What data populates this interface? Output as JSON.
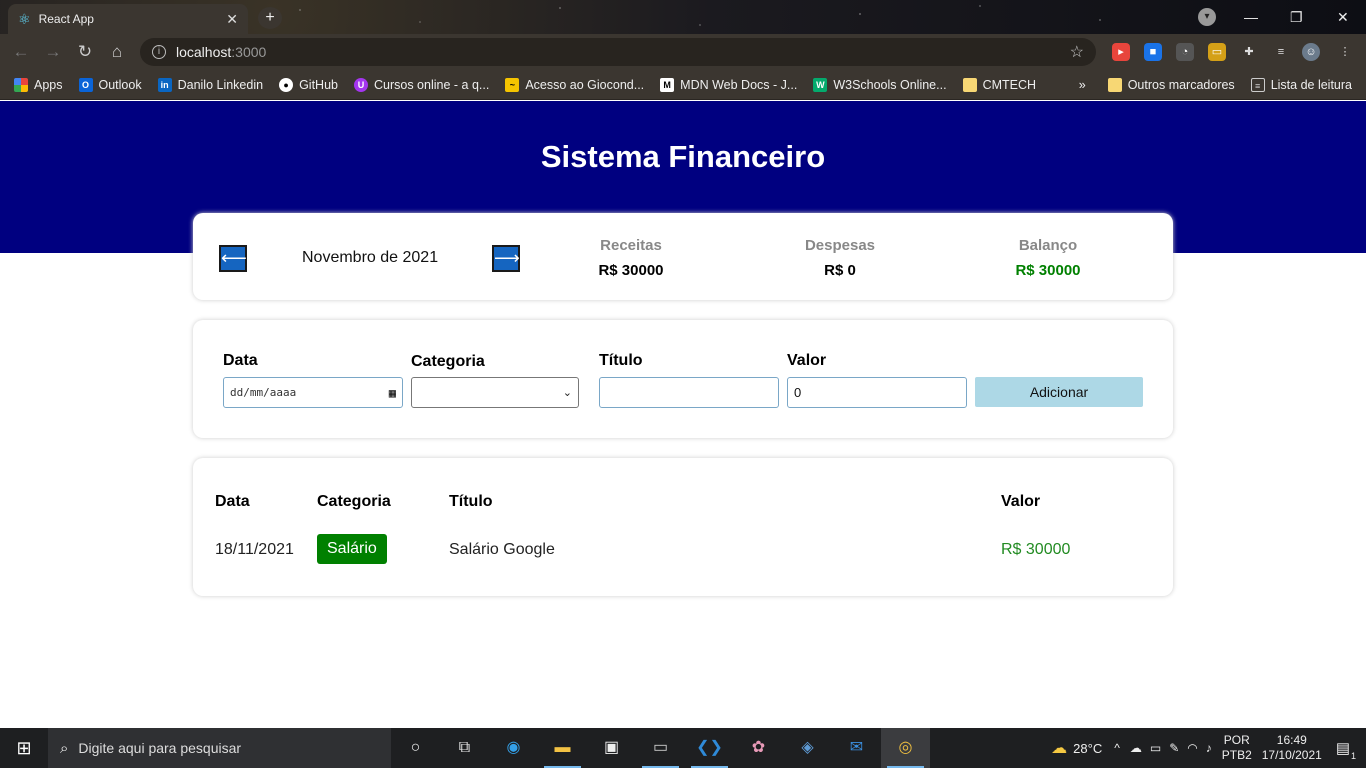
{
  "browser": {
    "tab_title": "React App",
    "tab_close": "✕",
    "new_tab": "+",
    "url_host": "localhost",
    "url_port": ":3000",
    "window_minimize": "—",
    "window_restore": "❐",
    "window_close": "✕",
    "bookmarks": [
      {
        "label": "Apps",
        "icon": "apps-grid-icon",
        "color": "#e8453c"
      },
      {
        "label": "Outlook",
        "icon": "outlook-icon",
        "color": "#0a64d8"
      },
      {
        "label": "Danilo Linkedin",
        "icon": "linkedin-icon",
        "color": "#0a66c2"
      },
      {
        "label": "GitHub",
        "icon": "github-icon",
        "color": "#ffffff"
      },
      {
        "label": "Cursos online - a q...",
        "icon": "udemy-icon",
        "color": "#a435f0"
      },
      {
        "label": "Acesso ao Giocond...",
        "icon": "bookmark-site-icon",
        "color": "#f5c400"
      },
      {
        "label": "MDN Web Docs - J...",
        "icon": "mdn-icon",
        "color": "#ffffff"
      },
      {
        "label": "W3Schools Online...",
        "icon": "w3schools-icon",
        "color": "#04aa6d"
      },
      {
        "label": "CMTECH",
        "icon": "folder-icon",
        "color": "#f7d774"
      }
    ],
    "bookmarks_overflow": "»",
    "other_bookmarks": "Outros marcadores",
    "reading_list": "Lista de leitura"
  },
  "app": {
    "title": "Sistema Financeiro",
    "prev_arrow": "⟵",
    "next_arrow": "⟶",
    "current_month": "Novembro de 2021",
    "summary": {
      "income_label": "Receitas",
      "income_value": "R$ 30000",
      "expense_label": "Despesas",
      "expense_value": "R$ 0",
      "balance_label": "Balanço",
      "balance_value": "R$ 30000"
    },
    "form": {
      "date_label": "Data",
      "date_placeholder": "dd/mm/aaaa",
      "category_label": "Categoria",
      "category_value": "",
      "title_label": "Título",
      "title_value": "",
      "value_label": "Valor",
      "value_value": "0",
      "add_button": "Adicionar"
    },
    "table": {
      "headers": [
        "Data",
        "Categoria",
        "Título",
        "Valor"
      ],
      "rows": [
        {
          "date": "18/11/2021",
          "category": "Salário",
          "title": "Salário Google",
          "value": "R$ 30000"
        }
      ]
    },
    "colors": {
      "header_band": "#000080",
      "arrow_button": "#1565c0",
      "positive": "#008000",
      "add_button": "#add8e6"
    }
  },
  "taskbar": {
    "search_placeholder": "Digite aqui para pesquisar",
    "weather": "28°C",
    "language": "POR",
    "keyboard": "PTB2",
    "time": "16:49",
    "date": "17/10/2021",
    "notifications": "1"
  }
}
